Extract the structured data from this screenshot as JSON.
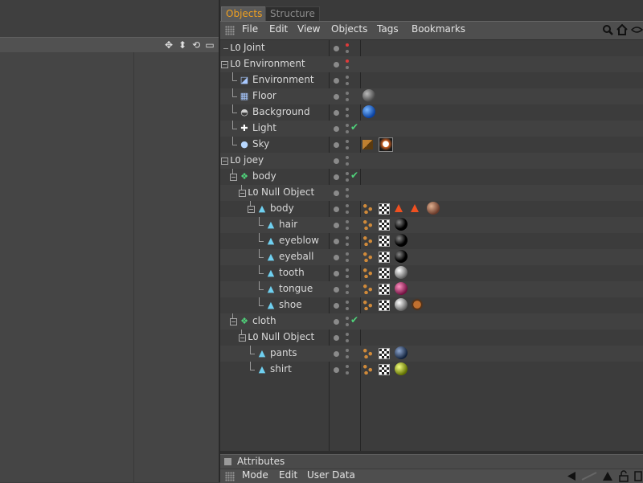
{
  "viewport": {
    "toolbar_icons": [
      "move-icon",
      "updown-icon",
      "rotate-icon",
      "maximize-icon"
    ]
  },
  "manager": {
    "tabs": [
      {
        "label": "Objects",
        "active": true
      },
      {
        "label": "Structure",
        "active": false
      }
    ],
    "menu": [
      "File",
      "Edit",
      "View",
      "Objects",
      "Tags",
      "Bookmarks"
    ],
    "menu_icons": [
      "search-icon",
      "home-icon",
      "eye-icon"
    ],
    "objects": [
      {
        "name": "Joint",
        "depth": 0,
        "icon": "null-icon",
        "flag": "red"
      },
      {
        "name": "Environment",
        "depth": 0,
        "icon": "null-icon",
        "flag": "red"
      },
      {
        "name": "Environment",
        "depth": 1,
        "icon": "environment-icon"
      },
      {
        "name": "Floor",
        "depth": 1,
        "icon": "floor-icon",
        "tags": [
          "ball-gray"
        ]
      },
      {
        "name": "Background",
        "depth": 1,
        "icon": "background-icon",
        "tags": [
          "ball-blue"
        ]
      },
      {
        "name": "Light",
        "depth": 1,
        "icon": "light-icon",
        "check": true
      },
      {
        "name": "Sky",
        "depth": 1,
        "icon": "sky-icon",
        "tags": [
          "clapper",
          "sky-tex"
        ]
      },
      {
        "name": "joey",
        "depth": 0,
        "icon": "null-icon"
      },
      {
        "name": "body",
        "depth": 1,
        "icon": "hypernurbs-icon",
        "check": true
      },
      {
        "name": "Null Object",
        "depth": 2,
        "icon": "null-icon"
      },
      {
        "name": "body",
        "depth": 3,
        "icon": "polygon-icon",
        "tags": [
          "uvw",
          "checker",
          "tri",
          "tri",
          "ball-brown"
        ]
      },
      {
        "name": "hair",
        "depth": 4,
        "icon": "polygon-icon",
        "tags": [
          "uvw",
          "checker",
          "ball-black"
        ]
      },
      {
        "name": "eyeblow",
        "depth": 4,
        "icon": "polygon-icon",
        "tags": [
          "uvw",
          "checker",
          "ball-black"
        ]
      },
      {
        "name": "eyeball",
        "depth": 4,
        "icon": "polygon-icon",
        "tags": [
          "uvw",
          "checker",
          "ball-black"
        ]
      },
      {
        "name": "tooth",
        "depth": 4,
        "icon": "polygon-icon",
        "tags": [
          "uvw",
          "checker",
          "ball-white"
        ]
      },
      {
        "name": "tongue",
        "depth": 4,
        "icon": "polygon-icon",
        "tags": [
          "uvw",
          "checker",
          "ball-pink"
        ]
      },
      {
        "name": "shoe",
        "depth": 4,
        "icon": "polygon-icon",
        "tags": [
          "uvw",
          "checker",
          "ball-white",
          "gear-tag"
        ]
      },
      {
        "name": "cloth",
        "depth": 1,
        "icon": "hypernurbs-icon",
        "check": true
      },
      {
        "name": "Null Object",
        "depth": 2,
        "icon": "null-icon"
      },
      {
        "name": "pants",
        "depth": 3,
        "icon": "polygon-icon",
        "tags": [
          "uvw",
          "checker",
          "ball-navy"
        ]
      },
      {
        "name": "shirt",
        "depth": 3,
        "icon": "polygon-icon",
        "tags": [
          "uvw",
          "checker",
          "ball-yellow"
        ]
      }
    ]
  },
  "attributes": {
    "title": "Attributes",
    "menu": [
      "Mode",
      "Edit",
      "User Data"
    ]
  },
  "colors": {
    "active_tab": "#f0a020",
    "check": "#4fd27a",
    "flag": "#e03a3a"
  }
}
